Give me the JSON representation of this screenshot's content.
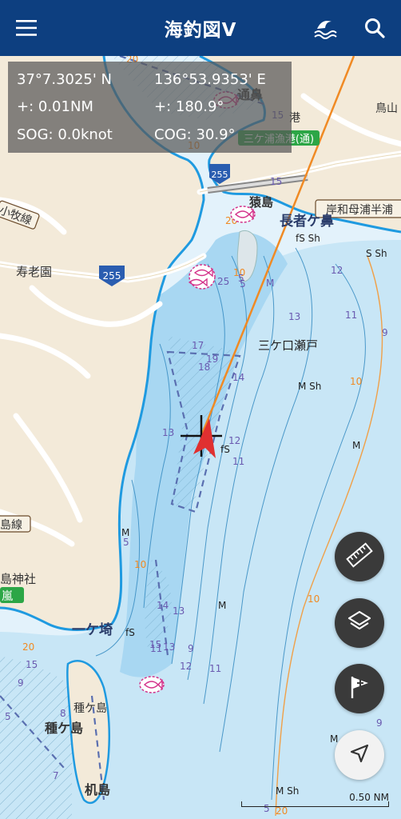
{
  "header": {
    "title": "海釣図Ⅴ",
    "menu_icon": "hamburger-menu-icon",
    "tide_icon": "wave-icon",
    "search_icon": "search-icon",
    "background_color": "#0d3f80"
  },
  "info_panel": {
    "latitude": "37°7.3025' N",
    "longitude": "136°53.9353' E",
    "distance": "+: 0.01NM",
    "bearing": "+: 180.9°",
    "sog": "SOG: 0.0knot",
    "cog": "COG: 30.9°"
  },
  "map": {
    "labels": {
      "tsuruhana": "通鼻",
      "port_tag": "港",
      "kanji_ri": "鳥山",
      "harbor": "三ケ浦漁港(通)",
      "sarushima": "猿島",
      "chojagahana": "長者ケ鼻",
      "coast_road": "岸和母浦半浦",
      "rail_line": "小牧線",
      "jurouen": "寿老園",
      "mikeguchi": "三ケ口瀬戸",
      "ichigasaki": "一ケ埼",
      "tanegashima_small": "種ケ島",
      "tanegashima": "種ケ島",
      "tsukueshima": "机島",
      "shrine": "島神社",
      "island_line": "島線",
      "storm_tag": "嵐",
      "route_255a": "255",
      "route_255b": "255"
    },
    "soundings": [
      "20",
      "10",
      "15",
      "20",
      "10",
      "5",
      "25",
      "5",
      "M",
      "12",
      "13",
      "11",
      "9",
      "17",
      "19",
      "18",
      "14",
      "fS Sh",
      "S Sh",
      "M Sh",
      "13",
      "12",
      "fS",
      "11",
      "10",
      "M",
      "M",
      "5",
      "10",
      "14",
      "13",
      "15",
      "12",
      "11",
      "20",
      "15",
      "9",
      "8",
      "7",
      "5",
      "M",
      "10",
      "M",
      "fS",
      "M Sh",
      "9",
      "5",
      "20",
      "15",
      "13",
      "11",
      "9"
    ],
    "land_color": "#f3ead9",
    "shallow_color": "#9fd3f0",
    "mid_color": "#c8e6f6",
    "deep_color": "#e3f2fb",
    "route_color": "#f08a24",
    "vessel_color": "#e03030",
    "fish_marker_color": "#d3328a"
  },
  "controls": {
    "ruler_icon": "ruler-icon",
    "layers_icon": "layers-icon",
    "add_flag_icon": "flag-plus-icon",
    "locate_icon": "navigation-arrow-icon"
  },
  "scale_bar": {
    "label": "0.50 NM"
  }
}
